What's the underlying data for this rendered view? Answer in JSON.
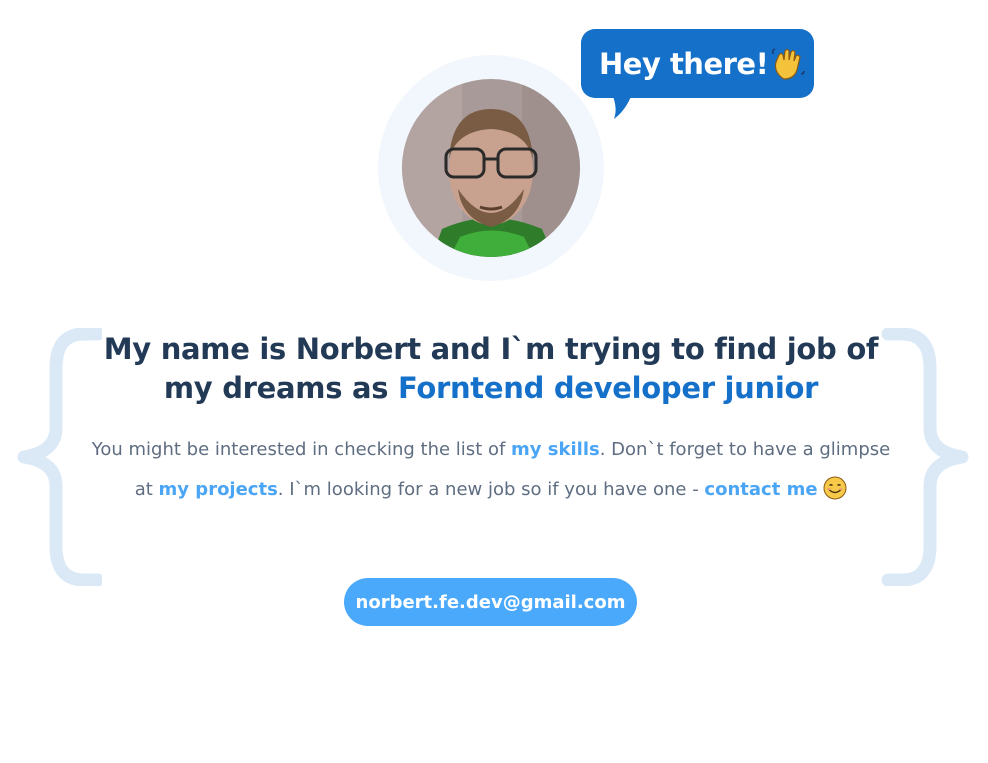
{
  "greeting": {
    "text": "Hey there!",
    "icon": "waving-hand-icon",
    "bubble_color": "#1570c9"
  },
  "avatar": {
    "alt": "Norbert"
  },
  "headline": {
    "before": "My name is Norbert and I`m trying to find job of my dreams as ",
    "accent": "Forntend developer junior",
    "accent_color": "#1570c9",
    "text_color": "#233a57"
  },
  "intro": {
    "part1": "You might be interested in checking the list of ",
    "skills_link": "my skills",
    "part2": ". Don`t forget to have a glimpse at ",
    "projects_link": "my projects",
    "part3": ". I`m looking for a new job so if you have one - ",
    "contact_link": "contact me",
    "emoji_icon": "smiling-face-icon",
    "link_color": "#4ba5f5"
  },
  "decor": {
    "braces_color": "#dbe9f7"
  },
  "email_button": {
    "label": "norbert.fe.dev@gmail.com",
    "color": "#4ba9fc"
  }
}
